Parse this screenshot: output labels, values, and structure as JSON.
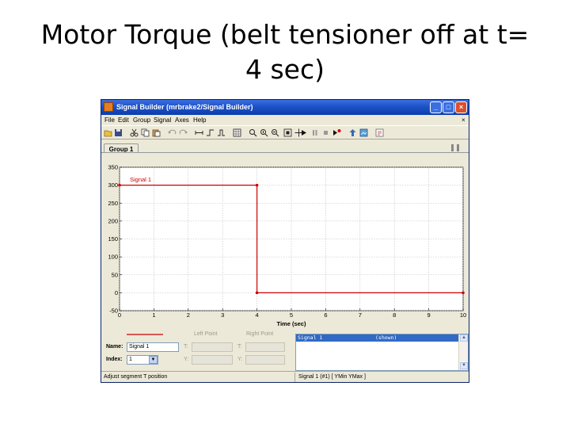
{
  "slide": {
    "title_line1": "Motor Torque (belt tensioner off at t=",
    "title_line2": "4 sec)"
  },
  "window": {
    "title": "Signal Builder (mrbrake2/Signal Builder)",
    "controls": {
      "minimize": "_",
      "maximize": "□",
      "close": "×"
    },
    "menu_close": "×"
  },
  "menu": [
    "File",
    "Edit",
    "Group",
    "Signal",
    "Axes",
    "Help"
  ],
  "toolbar_icons": [
    "open-icon",
    "save-icon",
    "cut-icon",
    "copy-icon",
    "paste-icon",
    "undo-icon",
    "redo-icon",
    "segment-h-icon",
    "step-icon",
    "pulse-icon",
    "square-wave-icon",
    "grid-icon",
    "zoom-x-icon",
    "zoom-y-icon",
    "zoom-xy-icon",
    "fit-icon",
    "pan-icon",
    "play-icon",
    "pause-icon",
    "stop-icon",
    "record-icon",
    "jump-icon",
    "bitmap-icon",
    "help-icon"
  ],
  "tab": {
    "label": "Group 1"
  },
  "chart_data": {
    "type": "line",
    "xlabel": "Time (sec)",
    "ylabel": "",
    "xlim": [
      0,
      10
    ],
    "ylim": [
      -50,
      350
    ],
    "xticks": [
      "0",
      "1",
      "2",
      "3",
      "4",
      "5",
      "6",
      "7",
      "8",
      "9",
      "10"
    ],
    "yticks": [
      "-50",
      "0",
      "50",
      "100",
      "150",
      "200",
      "250",
      "300",
      "350"
    ],
    "grid": true,
    "series": [
      {
        "name": "Signal 1",
        "x": [
          0,
          4,
          4,
          10
        ],
        "y": [
          300,
          300,
          0,
          0
        ]
      }
    ],
    "annotations": [
      "Signal 1"
    ]
  },
  "lower_panel": {
    "left_point": "Left Point",
    "right_point": "Right Point",
    "name_label": "Name:",
    "name_value": "Signal 1",
    "index_label": "Index:",
    "index_value": "1",
    "t_label": "T:",
    "y_label": "Y:",
    "list_row_name": "Signal 1",
    "list_row_state": "(shown)",
    "scroll_up": "▲",
    "scroll_down": "▼",
    "dropdown_arrow": "▼"
  },
  "status": {
    "left": "Adjust segment T position",
    "right": "Signal 1 (#1)  [ YMin YMax ]"
  },
  "colors": {
    "signal": "#cc0000",
    "titlebar": "#0a246a",
    "selection": "#316ac5"
  }
}
